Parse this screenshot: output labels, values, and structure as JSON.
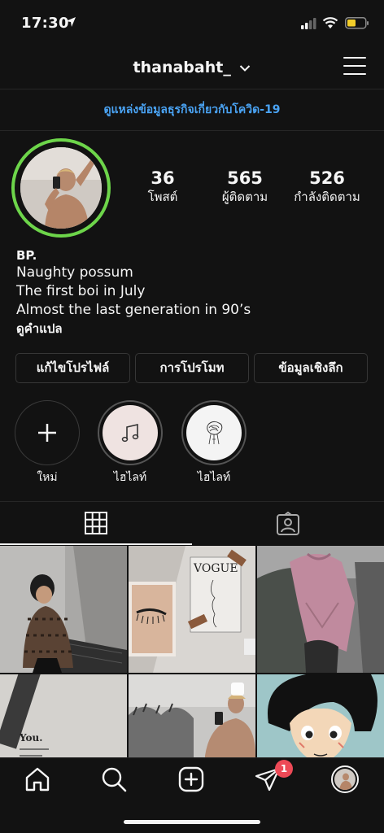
{
  "status_bar": {
    "time": "17:30"
  },
  "header": {
    "username": "thanabaht_"
  },
  "covid_banner": {
    "text": "ดูแหล่งข้อมูลธุรกิจเกี่ยวกับโควิด-19"
  },
  "stats": [
    {
      "count": "36",
      "label": "โพสต์"
    },
    {
      "count": "565",
      "label": "ผู้ติดตาม"
    },
    {
      "count": "526",
      "label": "กำลังติดตาม"
    }
  ],
  "bio": {
    "name": "BP.",
    "lines": [
      "Naughty possum",
      "The first boi in July",
      "Almost the last generation in 90’s"
    ],
    "translate_link": "ดูคำแปล"
  },
  "buttons": {
    "edit_profile": "แก้ไขโปรไฟล์",
    "promotions": "การโปรโมท",
    "insights": "ข้อมูลเชิงลึก"
  },
  "highlights": [
    {
      "label": "ใหม่",
      "icon": "plus-icon"
    },
    {
      "label": "ไฮไลท์",
      "icon": "music-note-icon"
    },
    {
      "label": "ไฮไลท์",
      "icon": "sketch-illustration"
    }
  ],
  "tabs": [
    {
      "icon": "grid-icon",
      "active": true
    },
    {
      "icon": "tagged-photos-icon",
      "active": false
    }
  ],
  "grid_posts": {
    "vogue_text": "VOGUE",
    "book_text": "You."
  },
  "bottom_nav": {
    "items": [
      "home-icon",
      "search-icon",
      "new-post-icon",
      "direct-messages-icon",
      "profile-avatar"
    ],
    "dm_badge": "1"
  },
  "colors": {
    "background": "#121212",
    "accent_link": "#4aa3f3",
    "story_ring": "#6dd54a",
    "badge": "#ed4956"
  }
}
